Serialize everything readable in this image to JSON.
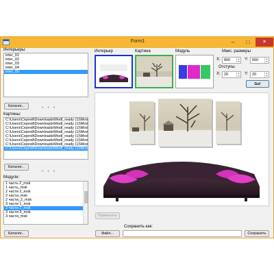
{
  "window": {
    "title": "Form1"
  },
  "controls": {
    "minimize": "–",
    "maximize": "□",
    "close": "✕"
  },
  "interiors": {
    "label": "Интерьеры:",
    "items": [
      "inter_01",
      "inter_02",
      "inter_03",
      "inter_04",
      "inter_05"
    ],
    "selected_index": 4,
    "catalog_button": "Каталог..."
  },
  "pictures": {
    "label": "Картины:",
    "items": [
      "C:\\Users\\Сергей\\Downloads\\Modl_ready (1)\\Mod",
      "C:\\Users\\Сергей\\Downloads\\Modl_ready (1)\\Mod",
      "C:\\Users\\Сергей\\Downloads\\Modl_ready (1)\\Mod",
      "C:\\Users\\Сергей\\Downloads\\Modl_ready (1)\\Mod",
      "C:\\Users\\Сергей\\Downloads\\Modl_ready (1)\\Mod",
      "C:\\Users\\Сергей\\Downloads\\Modl_ready (1)\\Mod",
      "C:\\Users\\Сергей\\Downloads\\Modl_ready (1)\\Mod",
      "C:\\Users\\Сергей\\Downloads\\Modl_ready (1)\\Mod"
    ],
    "selected_index": 7,
    "catalog_button": "Каталог..."
  },
  "modules": {
    "label": "Модули:",
    "items": [
      "1 часть 2_msk",
      "1 часть_msk",
      "2 части 2_msk",
      "2 части_msk",
      "2 части_2_msk",
      "3 части 1_msk",
      "3 части 2_msk",
      "3 части 3_msk",
      "3 части_msk"
    ],
    "selected_index": 6,
    "catalog_button": "Каталог..."
  },
  "preview": {
    "interior_label": "Интерьер",
    "picture_label": "Картина",
    "module_label": "Модуль"
  },
  "sizes": {
    "max_label": "Макс. размеры",
    "x_label": "X:",
    "x_value": "800",
    "y_label": "Y:",
    "y_value": "600",
    "gaps_label": "Отступы",
    "gx_label": "X:",
    "gx_value": "20",
    "gy_label": "Y:",
    "gy_value": "20",
    "go_button": "Go!"
  },
  "actions": {
    "apply_button": "Применить",
    "file_button": "Файл...",
    "save_as_label": "Сохранить как:",
    "save_as_value": "",
    "save_button": "Сохранить"
  },
  "colors": {
    "titlebar": "#f7b633",
    "selection": "#3399ff",
    "interior_thumb_border": "#1c2fd6",
    "picture_thumb_border": "#3bb14a",
    "sofa": "#3a2332",
    "cushion": "#e040c8"
  }
}
